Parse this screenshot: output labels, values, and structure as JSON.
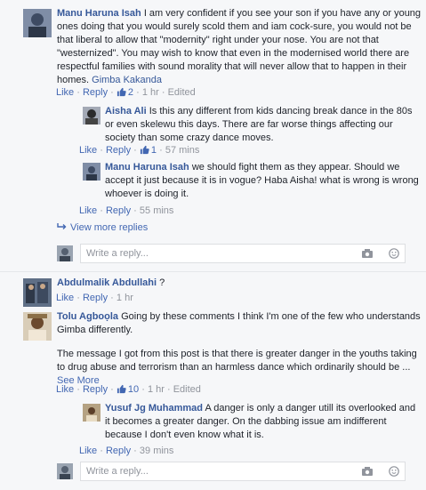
{
  "comments": [
    {
      "author": "Manu Haruna Isah",
      "text": "I am very confident if you see your son if you have any or young ones doing that you would surely scold them and iam cock-sure, you would not be that liberal to allow that \"modernity\" right under your nose. You are not that \"westernized\". You may wish to know that even in the modernised world there are respectful families with sound morality that will never allow that to happen in their homes.",
      "tag": "Gimba Kakanda",
      "like": "Like",
      "reply": "Reply",
      "likes": "2",
      "time": "1 hr",
      "edited": "Edited"
    },
    {
      "author": "Aisha Ali",
      "text": "Is this any different from kids dancing break dance in the 80s or even skelewu this days. There are far worse things affecting our society than some crazy dance moves.",
      "like": "Like",
      "reply": "Reply",
      "likes": "1",
      "time": "57 mins"
    },
    {
      "author": "Manu Haruna Isah",
      "text": "we should fight them as they appear. Should we accept it just because it is in vogue? Haba Aisha! what is wrong is wrong whoever is doing it.",
      "like": "Like",
      "reply": "Reply",
      "time": "55 mins"
    },
    {
      "author": "Abdulmalik Abdullahi",
      "text": "?",
      "like": "Like",
      "reply": "Reply",
      "time": "1 hr"
    },
    {
      "author": "Tolu Agboọla",
      "text": "Going by these comments I think I'm one of the few who understands Gimba differently.",
      "text2": "The message I got from this post is that there is greater danger in the youths taking to drug abuse and terrorism than an harmless dance which ordinarily should be ...",
      "see_more": "See More",
      "like": "Like",
      "reply": "Reply",
      "likes": "10",
      "time": "1 hr",
      "edited": "Edited"
    },
    {
      "author": "Yusuf Jg Muhammad",
      "text": "A danger is only a danger utill its overlooked and it becomes a greater danger. On the dabbing issue am indifferent because I don't even know what it is.",
      "like": "Like",
      "reply": "Reply",
      "time": "39 mins"
    }
  ],
  "view_more_replies": "View more replies",
  "reply_placeholder": "Write a reply...",
  "colors": {
    "link": "#4267b2",
    "name": "#365899",
    "meta": "#90949c",
    "bg": "#f6f7f9"
  },
  "icons": [
    "thumbs-up-icon",
    "reply-arrow-icon",
    "camera-icon",
    "emoji-icon"
  ]
}
